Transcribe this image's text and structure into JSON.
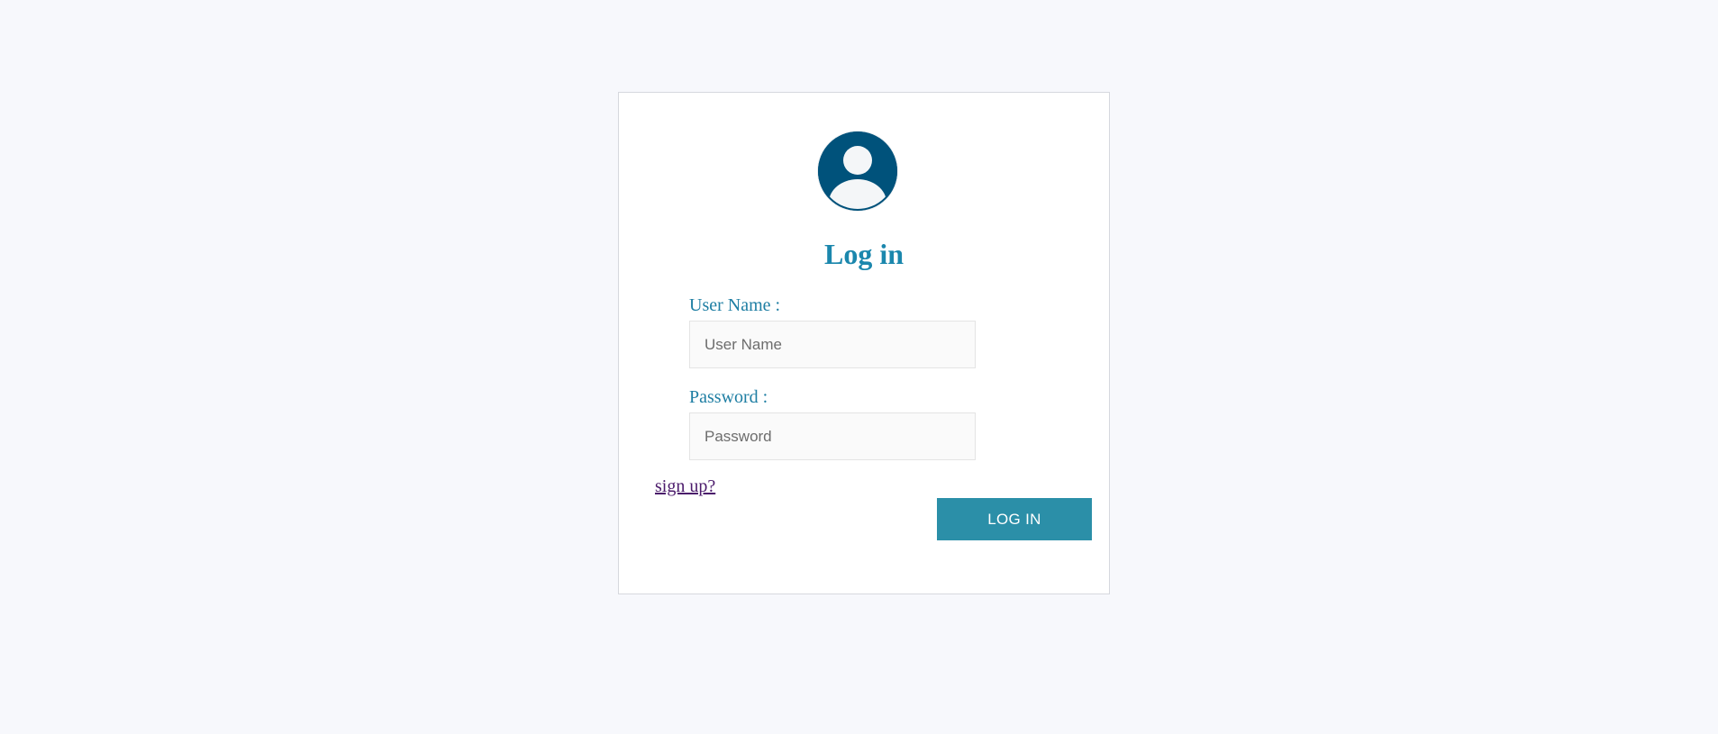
{
  "login": {
    "title": "Log in",
    "username_label": "User Name :",
    "username_placeholder": "User Name",
    "username_value": "",
    "password_label": "Password :",
    "password_placeholder": "Password",
    "password_value": "",
    "signup_link": "sign up?",
    "login_button": "LOG IN"
  },
  "icons": {
    "avatar": "user-avatar-icon"
  },
  "colors": {
    "page_background": "#f7f8fc",
    "card_background": "#ffffff",
    "avatar": "#00527b",
    "title": "#1b87ad",
    "label": "#1e7ea3",
    "button": "#2b8fa8",
    "link": "#4b1a6b"
  }
}
